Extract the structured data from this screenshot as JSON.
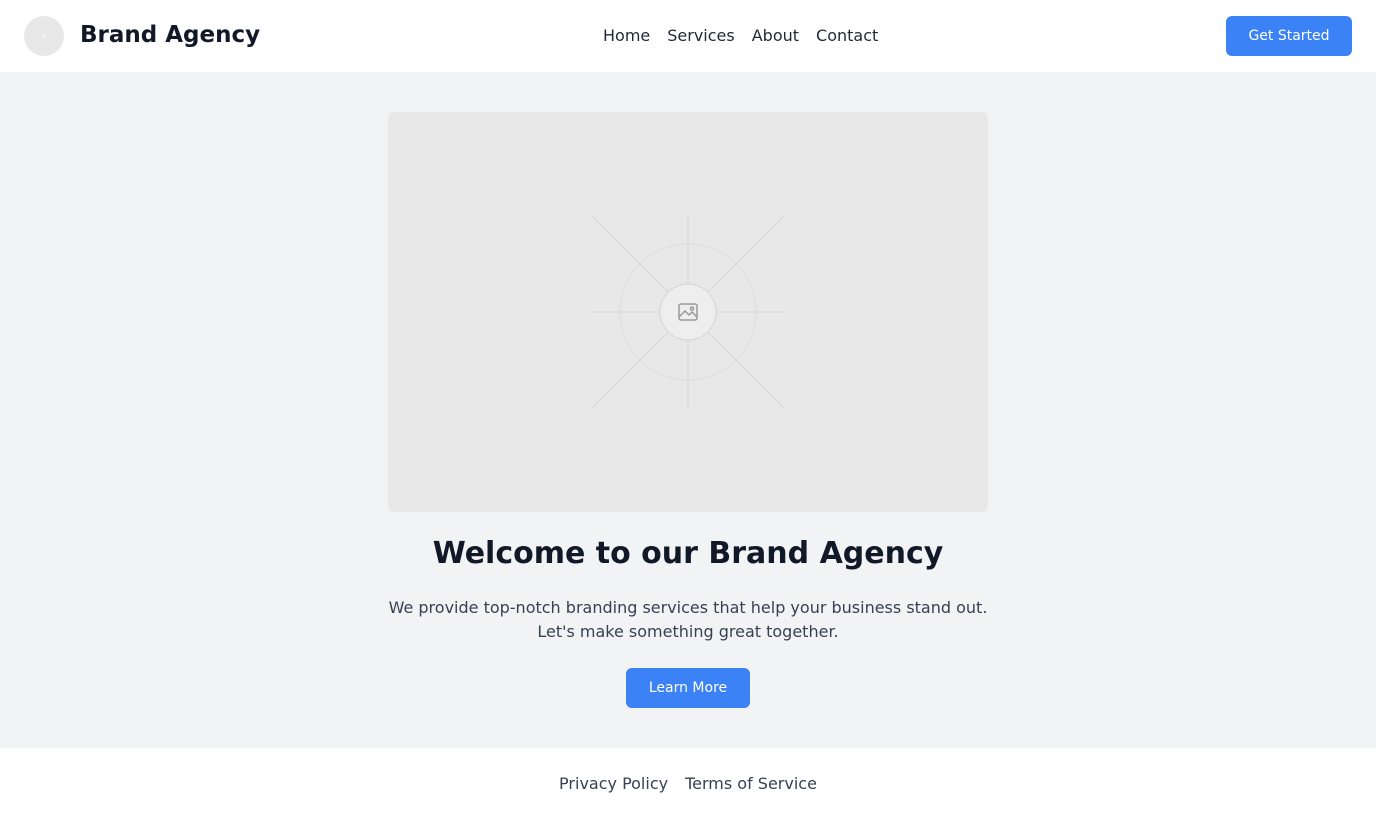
{
  "header": {
    "brand": "Brand Agency",
    "logo_icon": "logo-placeholder-icon",
    "nav": [
      {
        "label": "Home"
      },
      {
        "label": "Services"
      },
      {
        "label": "About"
      },
      {
        "label": "Contact"
      }
    ],
    "cta_label": "Get Started"
  },
  "hero": {
    "image_icon": "image-placeholder-icon",
    "title": "Welcome to our Brand Agency",
    "text_line1": "We provide top-notch branding services that help your business stand out.",
    "text_line2": "Let's make something great together.",
    "button_label": "Learn More"
  },
  "footer": {
    "links": [
      {
        "label": "Privacy Policy"
      },
      {
        "label": "Terms of Service"
      }
    ]
  },
  "colors": {
    "accent": "#3b82f6",
    "page_background": "#f1f3f5",
    "surface": "#ffffff",
    "placeholder": "#e8e8e8",
    "heading": "#111827",
    "body_text": "#374151"
  }
}
